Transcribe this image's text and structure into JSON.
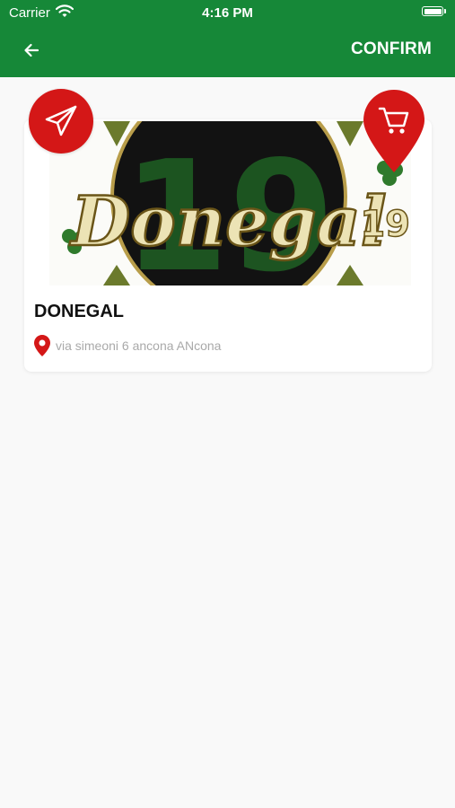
{
  "status_bar": {
    "carrier": "Carrier",
    "time": "4:16 PM"
  },
  "header": {
    "confirm_label": "CONFIRM",
    "back_icon": "arrow-left-icon"
  },
  "card": {
    "title": "DONEGAL",
    "address": "via simeoni 6 ancona ANcona",
    "image_logo_text": "Donegal",
    "image_logo_number": "19"
  },
  "actions": {
    "send_icon": "paper-plane-icon",
    "cart_icon": "shopping-cart-icon"
  },
  "colors": {
    "header_bg": "#168838",
    "accent_red": "#d41717",
    "background": "#f9f9f9",
    "address_text": "#a9a9a9"
  }
}
